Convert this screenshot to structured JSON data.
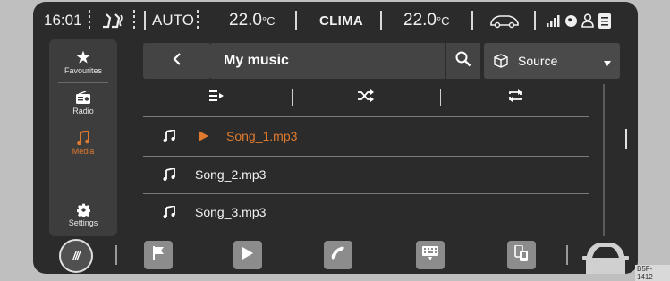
{
  "status_bar": {
    "time": "16:01",
    "auto_label": "AUTO",
    "temp_left_value": "22.0",
    "temp_left_unit": "°C",
    "clima_label": "CLIMA",
    "temp_right_value": "22.0",
    "temp_right_unit": "°C",
    "icons": [
      "seat-heating-icon",
      "car-icon",
      "signal-icon",
      "globe-icon",
      "user-icon",
      "message-icon"
    ]
  },
  "sidebar": {
    "items": [
      {
        "label": "Favourites",
        "icon": "star-icon"
      },
      {
        "label": "Radio",
        "icon": "radio-icon"
      },
      {
        "label": "Media",
        "icon": "music-note-icon",
        "active": true
      },
      {
        "label": "Settings",
        "icon": "gear-icon"
      }
    ]
  },
  "header": {
    "title": "My music",
    "source_label": "Source"
  },
  "controls": [
    "playlist-icon",
    "shuffle-icon",
    "repeat-icon"
  ],
  "songs": [
    {
      "name": "Song_1.mp3",
      "playing": true
    },
    {
      "name": "Song_2.mp3",
      "playing": false
    },
    {
      "name": "Song_3.mp3",
      "playing": false
    }
  ],
  "dock": {
    "home_label": "///",
    "icons": [
      "flag-icon",
      "play-icon",
      "phone-icon",
      "keyboard-icon",
      "phone-connect-icon",
      "car-icon"
    ]
  },
  "image_code": "B5F-1412",
  "colors": {
    "accent": "#e07a2e",
    "background": "#2b2b2b"
  }
}
